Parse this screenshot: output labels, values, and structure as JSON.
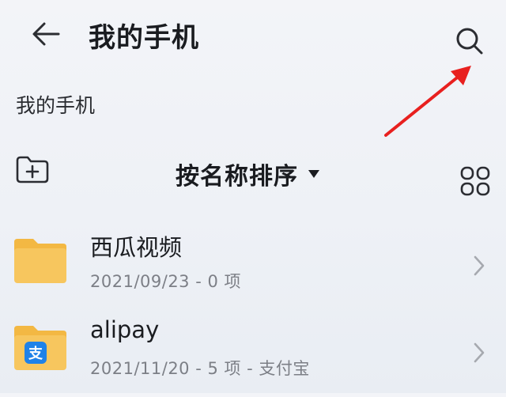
{
  "header": {
    "title": "我的手机",
    "back_icon": "arrow-left-icon",
    "search_icon": "search-icon"
  },
  "breadcrumb": {
    "path": "我的手机"
  },
  "toolbar": {
    "new_folder_icon": "new-folder-icon",
    "sort_label": "按名称排序",
    "sort_caret_icon": "caret-down-icon",
    "view_toggle_icon": "grid-view-icon"
  },
  "files": [
    {
      "name": "西瓜视频",
      "meta": "2021/09/23 - 0 项",
      "icon": "folder-icon"
    },
    {
      "name": "alipay",
      "meta": "2021/11/20 - 5 项 - 支付宝",
      "icon": "alipay-folder-icon",
      "badge_glyph": "支"
    }
  ],
  "colors": {
    "folder": "#f7c65e",
    "folder_back": "#f3b843",
    "alipay_badge": "#1f82e8",
    "annotation_arrow": "#e8201f",
    "meta_text": "#7c7f86"
  }
}
